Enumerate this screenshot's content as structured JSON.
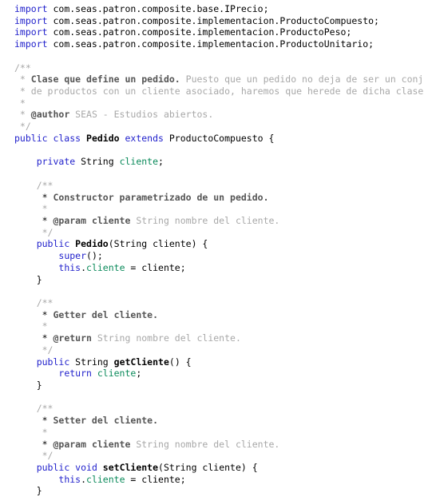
{
  "editor": {
    "language": "java",
    "background_color": "#ffffff",
    "colors": {
      "keyword": "#2222cc",
      "field": "#0a8a5a",
      "declaration": "#000000",
      "plain_text": "#000000",
      "comment": "#a8a8a8",
      "comment_bold": "#555555"
    }
  },
  "code": {
    "imports": [
      {
        "keyword": "import",
        "path": " com.seas.patron.composite.base.IPrecio;"
      },
      {
        "keyword": "import",
        "path": " com.seas.patron.composite.implementacion.ProductoCompuesto;"
      },
      {
        "keyword": "import",
        "path": " com.seas.patron.composite.implementacion.ProductoPeso;"
      },
      {
        "keyword": "import",
        "path": " com.seas.patron.composite.implementacion.ProductoUnitario;"
      }
    ],
    "class_javadoc": {
      "open": "/**",
      "bold_summary": "Clase que define un pedido.",
      "body_line_1": " Puesto que un pedido no deja de ser un conjunto",
      "body_line_2": " de productos con un cliente asociado, haremos que herede de dicha clase.",
      "star": " *",
      "author_tag": "@author",
      "author_value": " SEAS - Estudios abiertos.",
      "close": " */"
    },
    "class_declaration": {
      "modifiers": "public class ",
      "name": "Pedido",
      "extends_keyword": " extends ",
      "superclass": "ProductoCompuesto",
      "brace": " {"
    },
    "field": {
      "modifier": "private",
      "type": " String ",
      "name": "cliente",
      "semicolon": ";"
    },
    "constructor_javadoc": {
      "open": "/**",
      "summary": "Constructor parametrizado de un pedido.",
      "star": " *",
      "param_tag": "@param",
      "param_name": " cliente",
      "param_desc": " String nombre del cliente.",
      "close": " */"
    },
    "constructor": {
      "modifier": "public",
      "name": " Pedido",
      "params": "(String cliente) {",
      "super_call_keyword": "super",
      "super_call_rest": "();",
      "this_keyword": "this",
      "assign_dot": ".",
      "assign_field": "cliente",
      "assign_rest": " = cliente;",
      "close_brace": "}"
    },
    "getter_javadoc": {
      "open": "/**",
      "summary": "Getter del cliente.",
      "star": " *",
      "return_tag": "@return",
      "return_desc": " String nombre del cliente.",
      "close": " */"
    },
    "getter": {
      "modifier": "public",
      "type": " String ",
      "name": "getCliente",
      "params": "() {",
      "return_keyword": "return",
      "return_field": " cliente",
      "return_semicolon": ";",
      "close_brace": "}"
    },
    "setter_javadoc": {
      "open": "/**",
      "summary": "Setter del cliente.",
      "star": " *",
      "param_tag": "@param",
      "param_name": " cliente",
      "param_desc": " String nombre del cliente.",
      "close": " */"
    },
    "setter": {
      "modifier": "public",
      "type": " void ",
      "name": "setCliente",
      "params": "(String cliente) {",
      "this_keyword": "this",
      "assign_dot": ".",
      "assign_field": "cliente",
      "assign_rest": " = cliente;",
      "close_brace": "}"
    }
  }
}
